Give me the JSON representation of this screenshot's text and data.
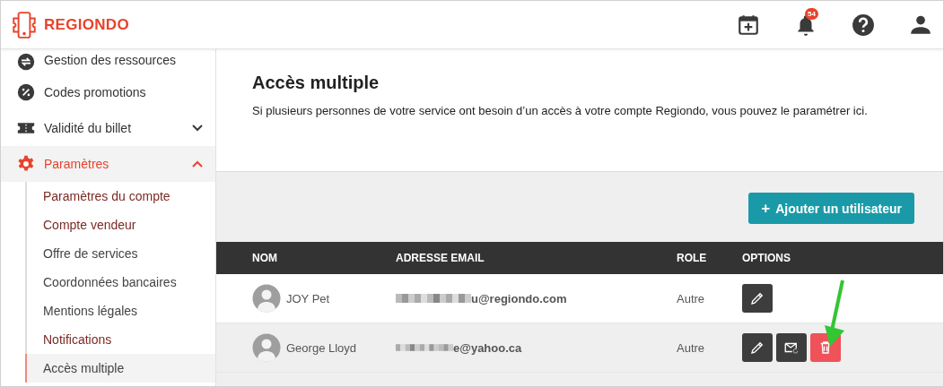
{
  "header": {
    "brand": "REGIONDO",
    "notifications_badge": "54"
  },
  "sidebar": {
    "items": [
      {
        "label": "Gestion des ressources",
        "selected": false
      },
      {
        "label": "Codes promotions",
        "selected": false
      },
      {
        "label": "Validité du billet",
        "expanded": false,
        "selected": false
      },
      {
        "label": "Paramètres",
        "expanded": true,
        "selected": true,
        "children": [
          {
            "label": "Paramètres du compte",
            "color": "#7a2a24",
            "selected": false
          },
          {
            "label": "Compte vendeur",
            "color": "#7a2a24",
            "selected": false
          },
          {
            "label": "Offre de services",
            "color": "#444444",
            "selected": false
          },
          {
            "label": "Coordonnées bancaires",
            "color": "#444444",
            "selected": false
          },
          {
            "label": "Mentions légales",
            "color": "#444444",
            "selected": false
          },
          {
            "label": "Notifications",
            "color": "#7a2a24",
            "selected": false
          },
          {
            "label": "Accès multiple",
            "color": "#444444",
            "selected": true
          }
        ]
      }
    ]
  },
  "page": {
    "title": "Accès multiple",
    "description": "Si plusieurs personnes de votre service ont besoin d’un accès à votre compte Regiondo, vous pouvez le paramétrer ici."
  },
  "add_button": {
    "icon": "+",
    "label": "Ajouter un utilisateur"
  },
  "table": {
    "columns": [
      "NOM",
      "ADRESSE EMAIL",
      "ROLE",
      "OPTIONS"
    ],
    "rows": [
      {
        "name": "JOY Pet",
        "email": "u@regiondo.com",
        "email_redacted": true,
        "role": "Autre",
        "actions": [
          {
            "kind": "edit"
          }
        ],
        "selected": false
      },
      {
        "name": "George Lloyd",
        "email": "e@yahoo.ca",
        "email_redacted": true,
        "role": "Autre",
        "actions": [
          {
            "kind": "edit"
          },
          {
            "kind": "resend"
          },
          {
            "kind": "delete"
          }
        ],
        "selected": true
      }
    ]
  },
  "annotation_arrow": {
    "color": "#33c633"
  }
}
